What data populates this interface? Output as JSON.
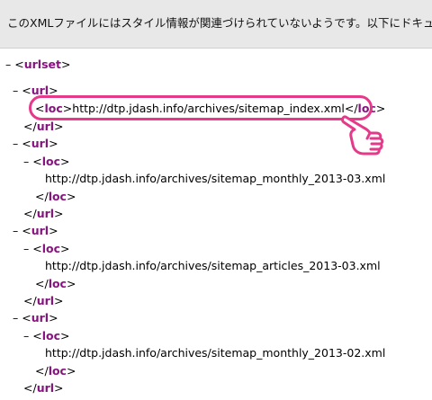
{
  "banner": {
    "message": "このXMLファイルにはスタイル情報が関連づけられていないようです。以下にドキュメントツリーを表示します。"
  },
  "xml": {
    "toggle_glyph": "–",
    "root_tag": "urlset",
    "url_tag": "url",
    "loc_tag": "loc",
    "locations": [
      "http://dtp.jdash.info/archives/sitemap_index.xml",
      "http://dtp.jdash.info/archives/sitemap_monthly_2013-03.xml",
      "http://dtp.jdash.info/archives/sitemap_articles_2013-03.xml",
      "http://dtp.jdash.info/archives/sitemap_monthly_2013-02.xml"
    ]
  },
  "annotation": {
    "highlight_color": "#e6398a",
    "pointer_icon": "pointing-hand-icon"
  }
}
